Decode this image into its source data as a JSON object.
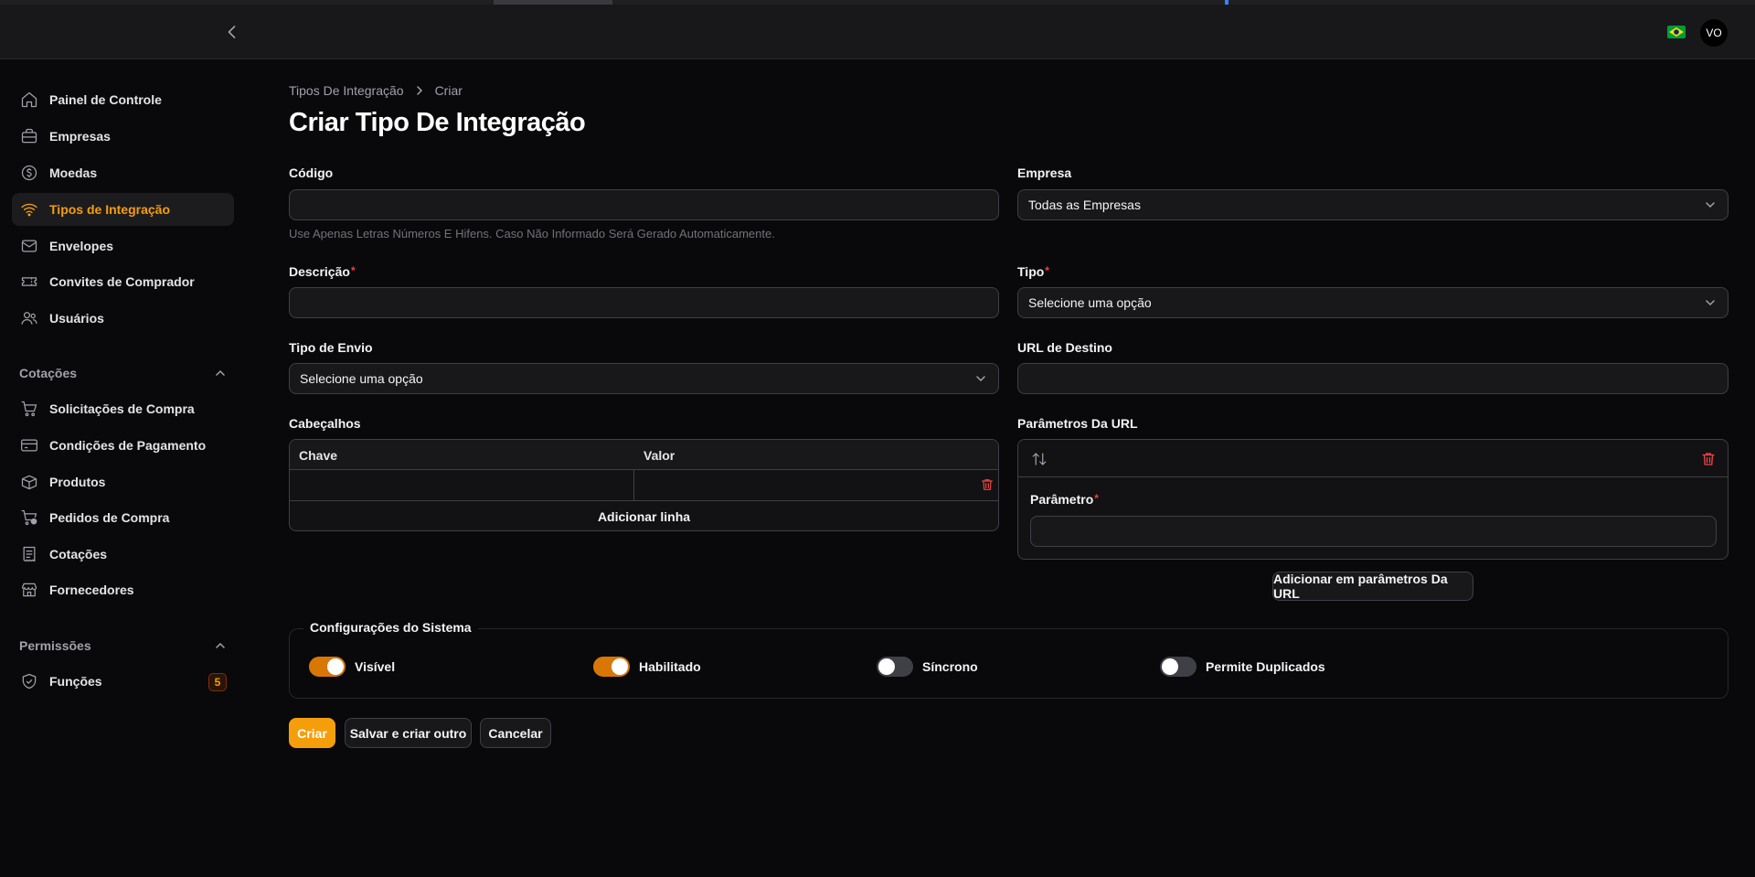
{
  "topbar": {
    "avatar_initials": "VO"
  },
  "sidebar": {
    "items": [
      {
        "label": "Painel de Controle",
        "icon": "home-icon"
      },
      {
        "label": "Empresas",
        "icon": "briefcase-icon"
      },
      {
        "label": "Moedas",
        "icon": "currency-dollar-icon"
      },
      {
        "label": "Tipos de Integração",
        "icon": "wifi-icon",
        "active": true
      },
      {
        "label": "Envelopes",
        "icon": "envelope-icon"
      },
      {
        "label": "Convites de Comprador",
        "icon": "ticket-icon"
      },
      {
        "label": "Usuários",
        "icon": "users-icon"
      }
    ],
    "groups": [
      {
        "label": "Cotações",
        "items": [
          {
            "label": "Solicitações de Compra",
            "icon": "shopping-cart-icon"
          },
          {
            "label": "Condições de Pagamento",
            "icon": "credit-card-icon"
          },
          {
            "label": "Produtos",
            "icon": "cube-icon"
          },
          {
            "label": "Pedidos de Compra",
            "icon": "cart-check-icon"
          },
          {
            "label": "Cotações",
            "icon": "receipt-icon"
          },
          {
            "label": "Fornecedores",
            "icon": "building-store-icon"
          }
        ]
      },
      {
        "label": "Permissões",
        "items": [
          {
            "label": "Funções",
            "icon": "shield-check-icon",
            "badge": "5"
          }
        ]
      }
    ]
  },
  "breadcrumb": {
    "parent": "Tipos De Integração",
    "current": "Criar"
  },
  "page_title": "Criar Tipo De Integração",
  "form": {
    "codigo": {
      "label": "Código",
      "value": "",
      "help": "Use Apenas Letras Números E Hifens. Caso Não Informado Será Gerado Automaticamente."
    },
    "empresa": {
      "label": "Empresa",
      "value": "Todas as Empresas"
    },
    "descricao": {
      "label": "Descrição",
      "required_mark": "*",
      "value": ""
    },
    "tipo": {
      "label": "Tipo",
      "required_mark": "*",
      "value": "Selecione uma opção"
    },
    "tipo_envio": {
      "label": "Tipo de Envio",
      "value": "Selecione uma opção"
    },
    "url_destino": {
      "label": "URL de Destino",
      "value": ""
    },
    "cabecalhos": {
      "label": "Cabeçalhos",
      "col_key": "Chave",
      "col_value": "Valor",
      "add_row": "Adicionar linha"
    },
    "parametros": {
      "label": "Parâmetros Da URL",
      "item_label": "Parâmetro",
      "required_mark": "*",
      "value": "",
      "add_button": "Adicionar em parâmetros Da URL"
    }
  },
  "system_settings": {
    "legend": "Configurações do Sistema",
    "toggles": [
      {
        "label": "Visível",
        "on": true
      },
      {
        "label": "Habilitado",
        "on": true
      },
      {
        "label": "Síncrono",
        "on": false
      },
      {
        "label": "Permite Duplicados",
        "on": false
      }
    ]
  },
  "actions": {
    "create": "Criar",
    "save_and_create_another": "Salvar e criar outro",
    "cancel": "Cancelar"
  },
  "colors": {
    "accent": "#f59e0b",
    "background": "#09090b",
    "danger": "#ef4444"
  }
}
